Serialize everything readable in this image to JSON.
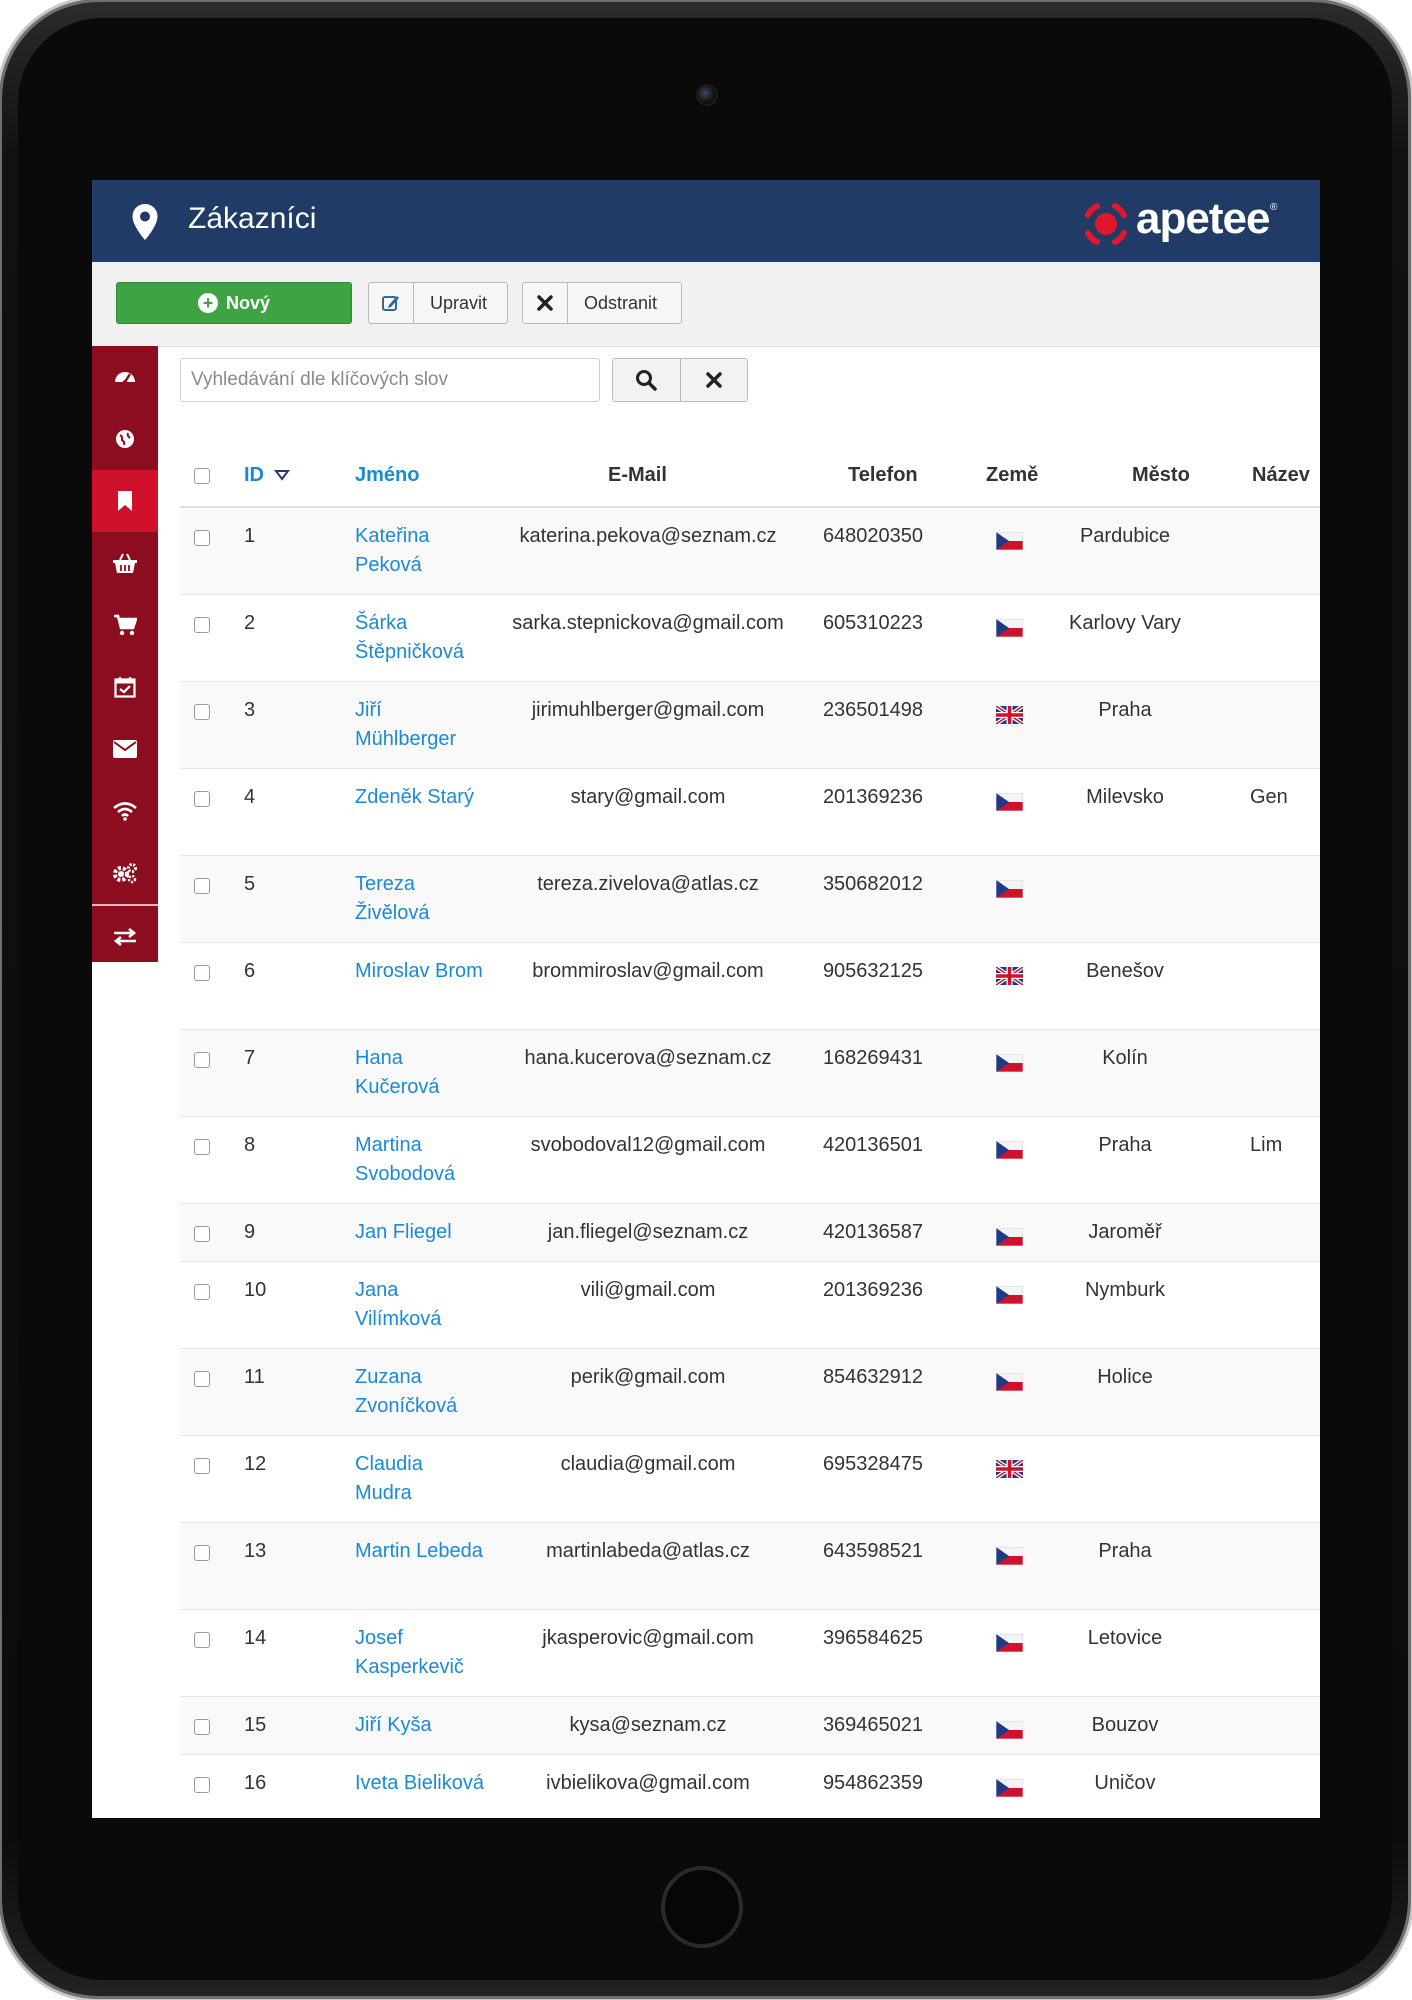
{
  "header": {
    "title": "Zákazníci",
    "logo_text": "apetee"
  },
  "toolbar": {
    "new_label": "Nový",
    "edit_label": "Upravit",
    "delete_label": "Odstranit"
  },
  "search": {
    "placeholder": "Vyhledávání dle klíčových slov"
  },
  "sidebar": {
    "items": [
      {
        "icon": "dashboard-icon"
      },
      {
        "icon": "globe-icon"
      },
      {
        "icon": "bookmark-icon",
        "active": true
      },
      {
        "icon": "basket-icon"
      },
      {
        "icon": "cart-icon"
      },
      {
        "icon": "calendar-icon"
      },
      {
        "icon": "envelope-icon"
      },
      {
        "icon": "wifi-icon"
      },
      {
        "icon": "gears-icon"
      },
      {
        "icon": "exchange-icon"
      }
    ]
  },
  "table": {
    "columns": {
      "id": "ID",
      "name": "Jméno",
      "email": "E-Mail",
      "phone": "Telefon",
      "country": "Země",
      "city": "Město",
      "company": "Název"
    },
    "sort": {
      "column": "ID",
      "direction": "desc-indicator"
    },
    "rows": [
      {
        "id": "1",
        "name": "Kateřina Peková",
        "email": "katerina.pekova@seznam.cz",
        "phone": "648020350",
        "country": "cz",
        "city": "Pardubice",
        "company": ""
      },
      {
        "id": "2",
        "name": "Šárka Štěpničková",
        "email": "sarka.stepnickova@gmail.com",
        "phone": "605310223",
        "country": "cz",
        "city": "Karlovy Vary",
        "company": ""
      },
      {
        "id": "3",
        "name": "Jiří Mühlberger",
        "email": "jirimuhlberger@gmail.com",
        "phone": "236501498",
        "country": "gb",
        "city": "Praha",
        "company": ""
      },
      {
        "id": "4",
        "name": "Zdeněk Starý",
        "email": "stary@gmail.com",
        "phone": "201369236",
        "country": "cz",
        "city": "Milevsko",
        "company": "Gen"
      },
      {
        "id": "5",
        "name": "Tereza Živělová",
        "email": "tereza.zivelova@atlas.cz",
        "phone": "350682012",
        "country": "cz",
        "city": "",
        "company": ""
      },
      {
        "id": "6",
        "name": "Miroslav Brom",
        "email": "brommiroslav@gmail.com",
        "phone": "905632125",
        "country": "gb",
        "city": "Benešov",
        "company": ""
      },
      {
        "id": "7",
        "name": "Hana Kučerová",
        "email": "hana.kucerova@seznam.cz",
        "phone": "168269431",
        "country": "cz",
        "city": "Kolín",
        "company": ""
      },
      {
        "id": "8",
        "name": "Martina Svobodová",
        "email": "svobodoval12@gmail.com",
        "phone": "420136501",
        "country": "cz",
        "city": "Praha",
        "company": "Lim"
      },
      {
        "id": "9",
        "name": "Jan Fliegel",
        "email": "jan.fliegel@seznam.cz",
        "phone": "420136587",
        "country": "cz",
        "city": "Jaroměř",
        "company": ""
      },
      {
        "id": "10",
        "name": "Jana Vilímková",
        "email": "vili@gmail.com",
        "phone": "201369236",
        "country": "cz",
        "city": "Nymburk",
        "company": ""
      },
      {
        "id": "11",
        "name": "Zuzana Zvoníčková",
        "email": "perik@gmail.com",
        "phone": "854632912",
        "country": "cz",
        "city": "Holice",
        "company": ""
      },
      {
        "id": "12",
        "name": "Claudia Mudra",
        "email": "claudia@gmail.com",
        "phone": "695328475",
        "country": "gb",
        "city": "",
        "company": ""
      },
      {
        "id": "13",
        "name": "Martin Lebeda",
        "email": "martinlabeda@atlas.cz",
        "phone": "643598521",
        "country": "cz",
        "city": "Praha",
        "company": ""
      },
      {
        "id": "14",
        "name": "Josef Kasperkevič",
        "email": "jkasperovic@gmail.com",
        "phone": "396584625",
        "country": "cz",
        "city": "Letovice",
        "company": ""
      },
      {
        "id": "15",
        "name": "Jiří Kyša",
        "email": "kysa@seznam.cz",
        "phone": "369465021",
        "country": "cz",
        "city": "Bouzov",
        "company": ""
      },
      {
        "id": "16",
        "name": "Iveta Bieliková",
        "email": "ivbielikova@gmail.com",
        "phone": "954862359",
        "country": "cz",
        "city": "Uničov",
        "company": ""
      }
    ]
  },
  "colors": {
    "header": "#1f3b66",
    "sidebar": "#8b0d1f",
    "sidebar_active": "#d0112b",
    "new_button": "#3ea443",
    "link": "#1a8ad4",
    "logo_accent": "#e0182d"
  }
}
